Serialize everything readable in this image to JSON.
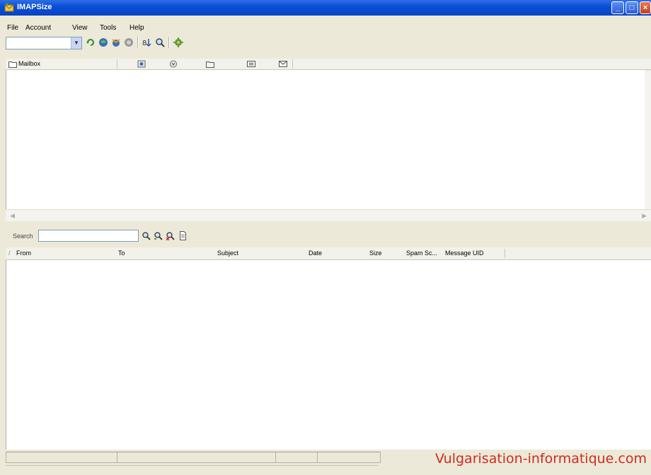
{
  "window": {
    "title": "IMAPSize"
  },
  "menu": {
    "items": [
      "File",
      "Account",
      "View",
      "Tools",
      "Help"
    ]
  },
  "toolbar": {
    "account_combo_value": "",
    "icons": [
      "refresh-icon",
      "connect-icon",
      "disconnect-icon",
      "stop-icon",
      "sort-icon",
      "find-icon",
      "settings-icon"
    ]
  },
  "mailbox_header": {
    "label": "Mailbox",
    "icons": [
      "total-size-icon",
      "attach-size-icon",
      "folder-icon",
      "messages-icon",
      "unread-icon"
    ]
  },
  "search": {
    "label": "Search",
    "value": ""
  },
  "message_columns": [
    "From",
    "To",
    "Subject",
    "Date",
    "Size",
    "Spam Sc...",
    "Message UID"
  ],
  "sort_indicator": "/",
  "watermark": "Vulgarisation-informatique.com"
}
